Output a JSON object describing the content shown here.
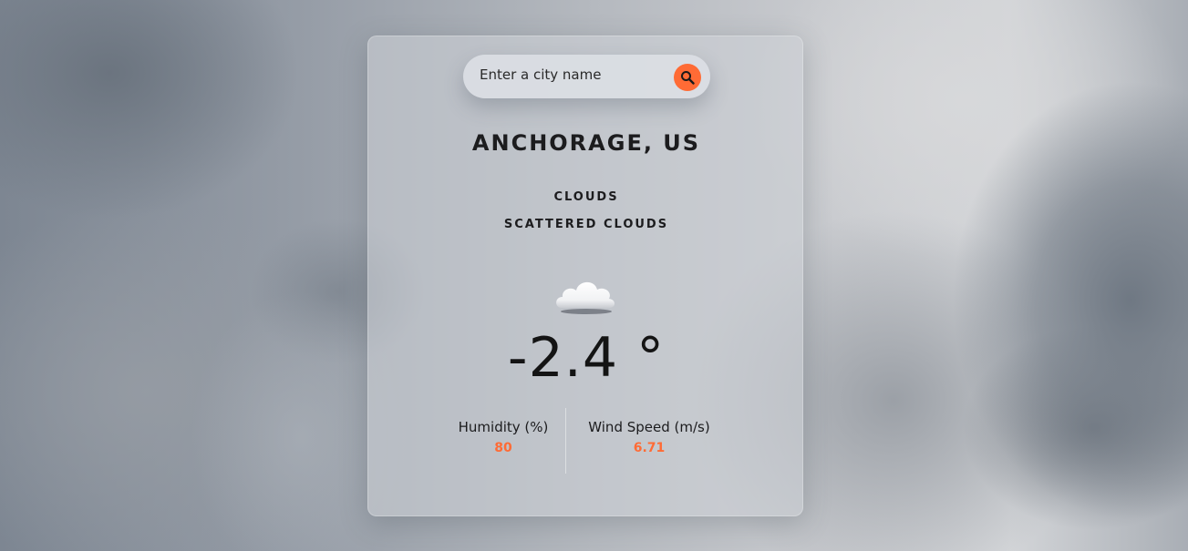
{
  "search": {
    "placeholder": "Enter a city name",
    "value": ""
  },
  "weather": {
    "city": "ANCHORAGE, US",
    "main": "CLOUDS",
    "description": "SCATTERED CLOUDS",
    "icon": "cloud-icon",
    "temperature": "-2.4 °"
  },
  "stats": {
    "humidity_label": "Humidity (%)",
    "humidity_value": "80",
    "wind_label": "Wind Speed (m/s)",
    "wind_value": "6.71"
  },
  "colors": {
    "accent": "#ff6b35",
    "text": "#1c1c1e"
  }
}
